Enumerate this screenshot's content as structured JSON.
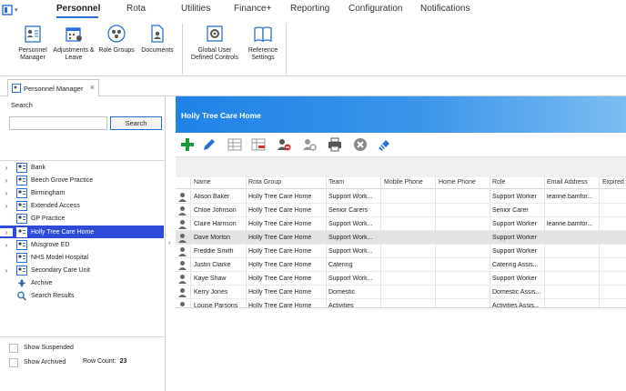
{
  "ribbon_tabs": [
    "Personnel",
    "Rota",
    "Utilities",
    "Finance+",
    "Reporting",
    "Configuration",
    "Notifications"
  ],
  "ribbon_buttons": {
    "personnel_manager": "Personnel Manager",
    "adjustments_leave": "Adjustments & Leave",
    "role_groups": "Role Groups",
    "documents": "Documents",
    "global_user_defined_controls": "Global User Defined Controls",
    "reference_settings": "Reference Settings"
  },
  "doc_tab": {
    "label": "Personnel Manager",
    "close": "×"
  },
  "search": {
    "label": "Search",
    "value": "",
    "button": "Search"
  },
  "tree": [
    {
      "label": "Bank",
      "expandable": true
    },
    {
      "label": "Beech Grove Practice",
      "expandable": true
    },
    {
      "label": "Birmingham",
      "expandable": true
    },
    {
      "label": "Extended Access",
      "expandable": true
    },
    {
      "label": "GP Practice",
      "expandable": false
    },
    {
      "label": "Holly Tree Care Home",
      "expandable": true,
      "selected": true
    },
    {
      "label": "Musgrove ED",
      "expandable": true
    },
    {
      "label": "NHS Model Hospital",
      "expandable": false
    },
    {
      "label": "Secondary Care Unit",
      "expandable": true
    },
    {
      "label": "Archive",
      "expandable": false,
      "icon": "archive-icon"
    },
    {
      "label": "Search Results",
      "expandable": false,
      "icon": "search-icon"
    }
  ],
  "footer": {
    "show_suspended": "Show Suspended",
    "show_archived": "Show Archived",
    "row_count_label": "Row Count:",
    "row_count": "23"
  },
  "banner_title": "Holly Tree Care Home",
  "grid": {
    "columns": [
      "Name",
      "Rota Group",
      "Team",
      "Mobile Phone",
      "Home Phone",
      "Role",
      "Email Address",
      "Expired"
    ],
    "rows": [
      [
        "Alison Baker",
        "Holly Tree Care Home",
        "Support Work...",
        "",
        "",
        "Support Worker",
        "leanne.bamfor...",
        ""
      ],
      [
        "Chloe Johnson",
        "Holly Tree Care Home",
        "Senior Carers",
        "",
        "",
        "Senior Carer",
        "",
        ""
      ],
      [
        "Claire Harrison",
        "Holly Tree Care Home",
        "Support Work...",
        "",
        "",
        "Support Worker",
        "leanne.bamfor...",
        ""
      ],
      [
        "Dave Morton",
        "Holly Tree Care Home",
        "Support Work...",
        "",
        "",
        "Support Worker",
        "",
        ""
      ],
      [
        "Freddie Smith",
        "Holly Tree Care Home",
        "Support Work...",
        "",
        "",
        "Support Worker",
        "",
        ""
      ],
      [
        "Justin Clarke",
        "Holly Tree Care Home",
        "Catering",
        "",
        "",
        "Catering Assis...",
        "",
        ""
      ],
      [
        "Kaye Shaw",
        "Holly Tree Care Home",
        "Support Work...",
        "",
        "",
        "Support Worker",
        "",
        ""
      ],
      [
        "Kerry Jones",
        "Holly Tree Care Home",
        "Domestic",
        "",
        "",
        "Domestic Assis...",
        "",
        ""
      ],
      [
        "Louise Parsons",
        "Holly Tree Care Home",
        "Activities",
        "",
        "",
        "Activities Assis...",
        "",
        ""
      ]
    ],
    "selected_row": 3
  },
  "colors": {
    "accent": "#2a6fd6",
    "tree_selected": "#2d4bd6",
    "banner": "#1f82e6",
    "add_green": "#1a9a3a"
  }
}
